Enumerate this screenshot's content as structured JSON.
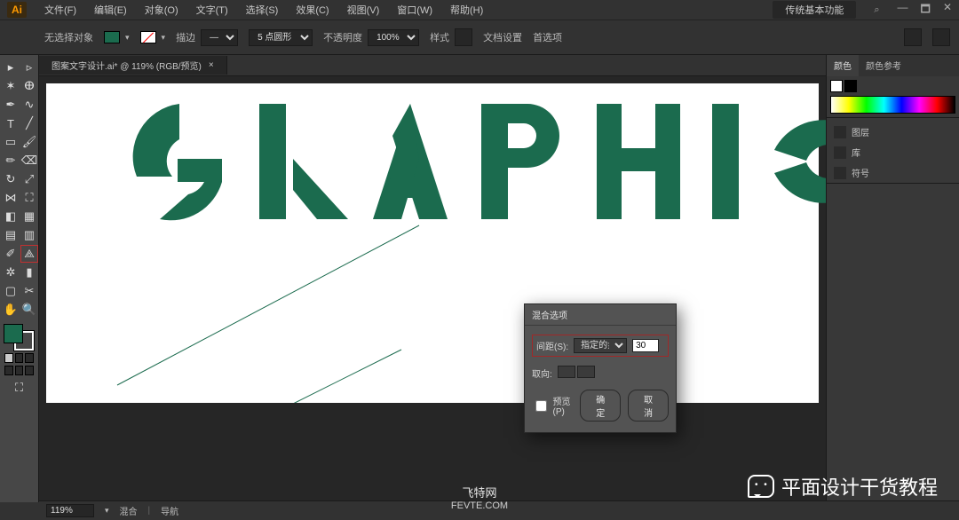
{
  "app": {
    "logo": "Ai",
    "workspace_label": "传统基本功能"
  },
  "menu": {
    "items": [
      "文件(F)",
      "编辑(E)",
      "对象(O)",
      "文字(T)",
      "选择(S)",
      "效果(C)",
      "视图(V)",
      "窗口(W)",
      "帮助(H)"
    ]
  },
  "options": {
    "label": "无选择对象",
    "stroke_label": "描边",
    "stroke_pt": "5 点圆形",
    "opacity_label": "不透明度",
    "opacity_value": "100%",
    "style_label": "样式",
    "docset": "文档设置",
    "prefs": "首选项"
  },
  "doc": {
    "tab": "图案文字设计.ai* @ 119% (RGB/预览)",
    "close": "×"
  },
  "dialog": {
    "title": "混合选项",
    "spacing_label": "间距(S):",
    "spacing_mode": "指定的步数",
    "spacing_value": "30",
    "orient_label": "取向:",
    "preview": "预览(P)",
    "ok": "确定",
    "cancel": "取消"
  },
  "panels": {
    "color_tab": "颜色",
    "guide_tab": "颜色参考",
    "lib_layers": "图层",
    "lib_libs": "库",
    "lib_symbols": "符号"
  },
  "status": {
    "zoom": "119%",
    "tool": "混合",
    "nav": "导航"
  },
  "watermark": {
    "site_cn": "飞特网",
    "site_en": "FEVTE.COM",
    "channel": "平面设计干货教程"
  }
}
